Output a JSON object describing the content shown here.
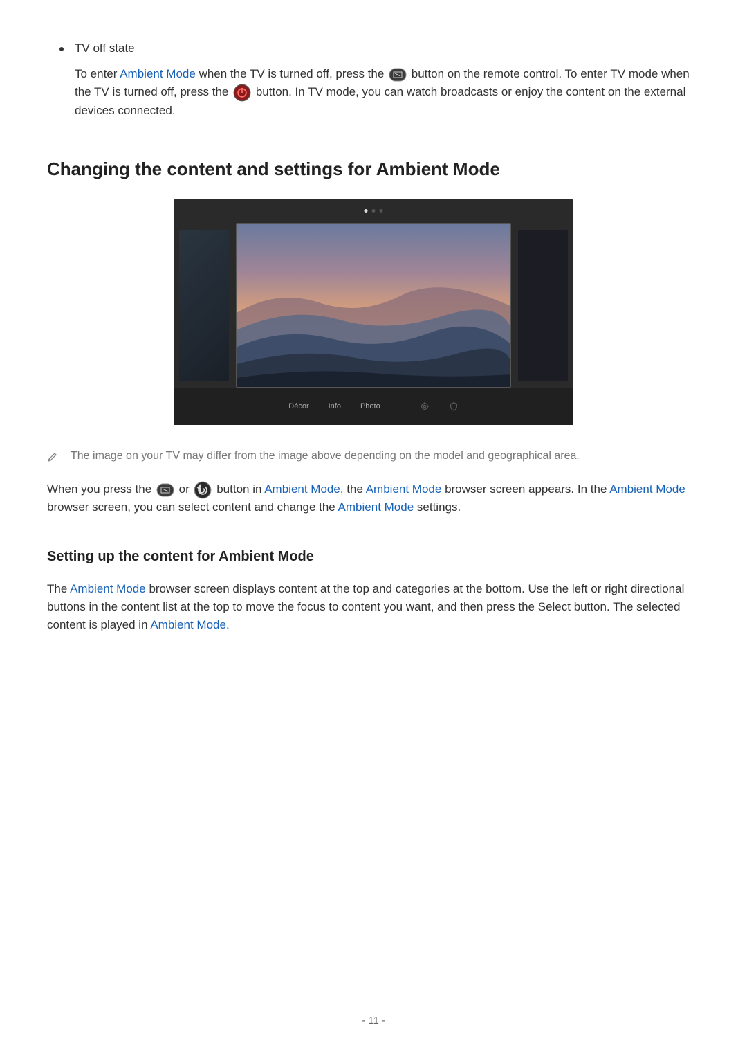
{
  "bullet": {
    "title": "TV off state",
    "p1_prefix": "To enter ",
    "p1_link1": "Ambient Mode",
    "p1_mid1": " when the TV is turned off, press the ",
    "p1_mid2": " button on the remote control. To enter TV mode when the TV is turned off, press the ",
    "p1_end": " button. In TV mode, you can watch broadcasts or enjoy the content on the external devices connected."
  },
  "heading2": "Changing the content and settings for Ambient Mode",
  "tv": {
    "cat1": "Décor",
    "cat2": "Info",
    "cat3": "Photo"
  },
  "note": "The image on your TV may differ from the image above depending on the model and geographical area.",
  "para2": {
    "a": "When you press the ",
    "b": " or ",
    "c": " button in ",
    "link1": "Ambient Mode",
    "d": ", the ",
    "link2": "Ambient Mode",
    "e": " browser screen appears. In the ",
    "link3": "Ambient Mode",
    "f": " browser screen, you can select content and change the ",
    "link4": "Ambient Mode",
    "g": " settings."
  },
  "heading3": "Setting up the content for Ambient Mode",
  "para3": {
    "a": "The ",
    "link1": "Ambient Mode",
    "b": " browser screen displays content at the top and categories at the bottom. Use the left or right directional buttons in the content list at the top to move the focus to content you want, and then press the Select button. The selected content is played in ",
    "link2": "Ambient Mode",
    "c": "."
  },
  "pageNumber": "- 11 -"
}
